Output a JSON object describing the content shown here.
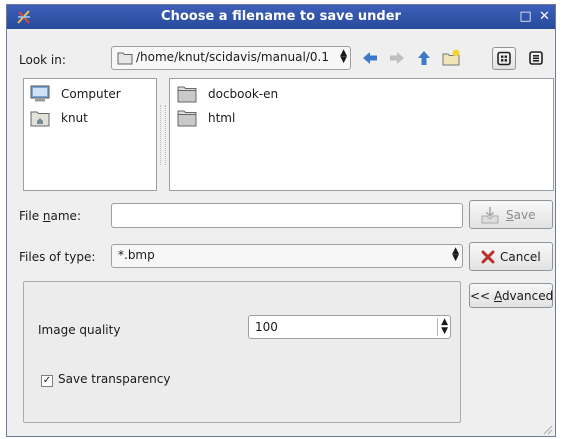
{
  "window": {
    "title": "Choose a filename to save under",
    "minimize": "□",
    "close": "✕"
  },
  "toolbar": {
    "look_in_label": "Look in:",
    "path": "/home/knut/scidavis/manual/0.1",
    "back_icon": "arrow-left-icon",
    "forward_icon": "arrow-right-icon",
    "up_icon": "arrow-up-icon",
    "new_folder_icon": "new-folder-icon",
    "list_view_icon": "list-view-icon",
    "detail_view_icon": "detail-view-icon"
  },
  "sidebar": {
    "items": [
      {
        "label": "Computer",
        "icon": "computer-icon"
      },
      {
        "label": "knut",
        "icon": "home-folder-icon"
      }
    ]
  },
  "files": {
    "items": [
      {
        "label": "docbook-en",
        "icon": "folder-icon"
      },
      {
        "label": "html",
        "icon": "folder-icon"
      }
    ]
  },
  "form": {
    "file_name_label_pre": "File ",
    "file_name_label_mn": "n",
    "file_name_label_post": "ame:",
    "file_name_value": "",
    "files_of_type_label": "Files of type:",
    "files_of_type_value": "*.bmp"
  },
  "buttons": {
    "save_mn": "S",
    "save_rest": "ave",
    "cancel": "Cancel",
    "advanced_pre": "<< ",
    "advanced_mn": "A",
    "advanced_rest": "dvanced"
  },
  "advanced": {
    "image_quality_label": "Image quality",
    "image_quality_value": "100",
    "save_transparency_label": "Save transparency",
    "save_transparency_checked": "✓"
  }
}
